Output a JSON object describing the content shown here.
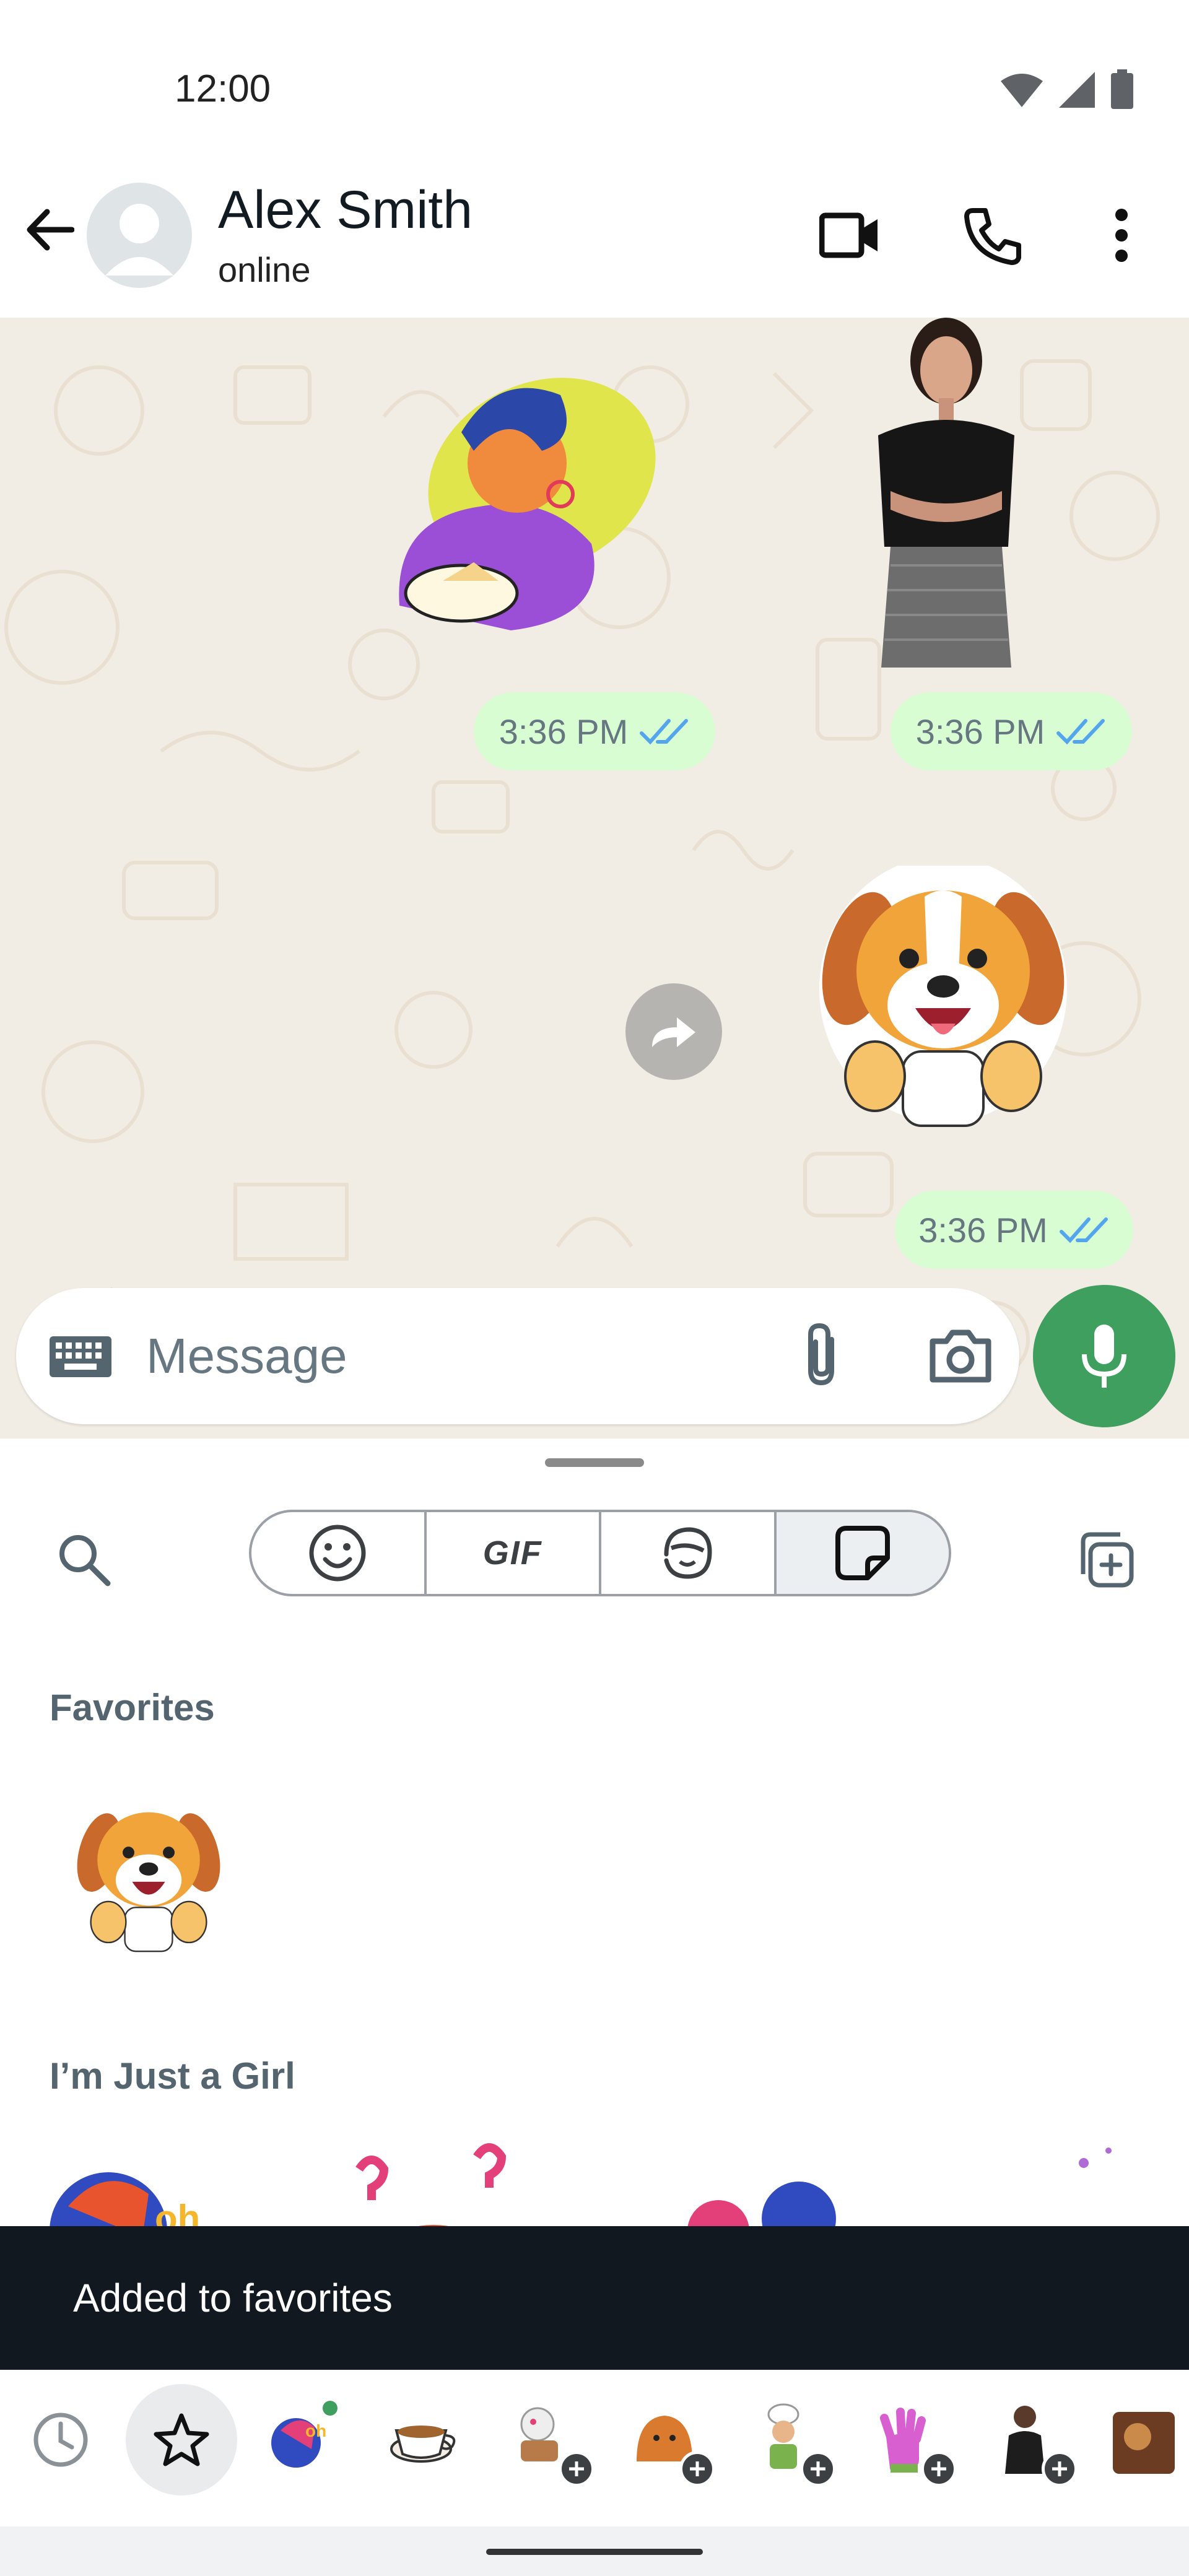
{
  "status_bar": {
    "time": "12:00",
    "icons": [
      "wifi-icon",
      "signal-icon",
      "battery-icon"
    ]
  },
  "header": {
    "contact_name": "Alex Smith",
    "contact_status": "online",
    "icons": [
      "back-arrow-icon",
      "video-call-icon",
      "voice-call-icon",
      "more-options-icon"
    ]
  },
  "messages": [
    {
      "type": "sticker",
      "sticker": "woman-with-cake-sticker",
      "time": "3:36 PM",
      "status_icon": "double-check-icon"
    },
    {
      "type": "sticker",
      "sticker": "woman-photo-sticker",
      "time": "3:36 PM",
      "status_icon": "double-check-icon"
    },
    {
      "type": "sticker",
      "sticker": "dog-thumbs-up-sticker",
      "time": "3:36 PM",
      "status_icon": "double-check-icon"
    }
  ],
  "composer": {
    "placeholder": "Message",
    "icons": [
      "keyboard-icon",
      "attach-icon",
      "camera-icon",
      "mic-icon"
    ]
  },
  "panel": {
    "tabs": [
      {
        "name": "emoji",
        "icon": "emoji-icon",
        "active": false
      },
      {
        "name": "gif",
        "label": "GIF",
        "active": false
      },
      {
        "name": "avatar",
        "icon": "avatar-icon",
        "active": false
      },
      {
        "name": "stickers",
        "icon": "sticker-icon",
        "active": true
      }
    ],
    "favorites_title": "Favorites",
    "favorites": [
      "dog-thumbs-up-sticker"
    ],
    "pack_title": "I’m Just a Girl"
  },
  "snackbar": {
    "text": "Added to favorites"
  },
  "tray": {
    "items": [
      "recent-icon",
      "favorites-star-icon",
      "pack-just-a-girl",
      "pack-coffee-cup",
      "pack-lamb",
      "pack-bread",
      "pack-chef",
      "pack-hand",
      "pack-person",
      "pack-photo"
    ]
  },
  "colors": {
    "accent_green": "#3f9f5f",
    "bubble": "#d9fdd3",
    "read_tick": "#53a6ee",
    "chat_background": "#f2ede4",
    "snackbar": "#111820"
  }
}
